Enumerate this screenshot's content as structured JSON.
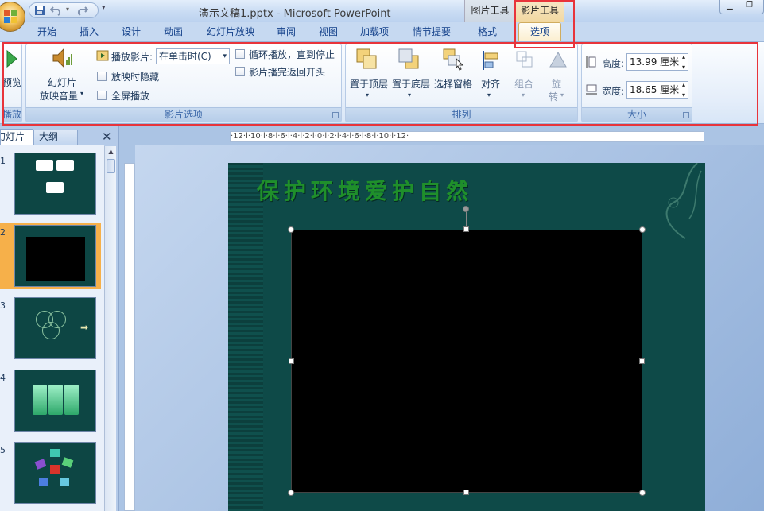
{
  "window": {
    "title": "演示文稿1.pptx - Microsoft PowerPoint",
    "context_tabs": [
      "图片工具",
      "影片工具"
    ]
  },
  "tabs": [
    "开始",
    "插入",
    "设计",
    "动画",
    "幻灯片放映",
    "审阅",
    "视图",
    "加载项",
    "情节提要",
    "格式",
    "选项"
  ],
  "active_tab": "选项",
  "ribbon": {
    "play_group": {
      "preview_label": "预览",
      "group_label": "播放"
    },
    "movie_options": {
      "volume_label_1": "幻灯片",
      "volume_label_2": "放映音量",
      "play_movie_label": "播放影片:",
      "play_movie_value": "在单击时(C)",
      "hide_label": "放映时隐藏",
      "fullscreen_label": "全屏播放",
      "loop_label": "循环播放，直到停止",
      "rewind_label": "影片播完返回开头",
      "group_label": "影片选项"
    },
    "arrange": {
      "front_label": "置于顶层",
      "back_label": "置于底层",
      "pane_label": "选择窗格",
      "align_label": "对齐",
      "group_label_btn": "组合",
      "rotate_label_1": "旋",
      "rotate_label_2": "转",
      "group_label": "排列"
    },
    "size": {
      "height_label": "高度:",
      "height_value": "13.99 厘米",
      "width_label": "宽度:",
      "width_value": "18.65 厘米",
      "group_label": "大小"
    }
  },
  "panel": {
    "tab_slides": "幻灯片",
    "tab_outline": "大纲",
    "slide_numbers": [
      "1",
      "2",
      "3",
      "4",
      "5"
    ]
  },
  "ruler": {
    "h_text": "·12·l·10·l·8·l·6·l·4·l·2·l·0·l·2·l·4·l·6·l·8·l·10·l·12·"
  },
  "slide": {
    "title": "保护环境爱护自然"
  },
  "colors": {
    "highlight": "#e8343b",
    "slide_bg": "#0e4a48",
    "title": "#1f8f2b"
  }
}
